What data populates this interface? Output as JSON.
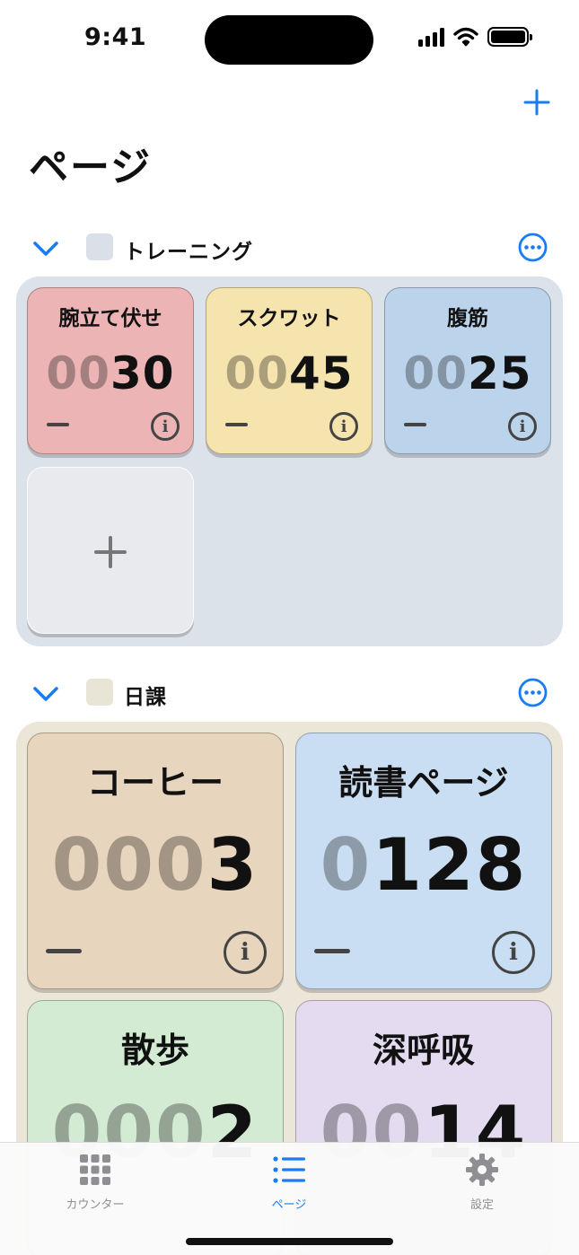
{
  "status": {
    "time": "9:41"
  },
  "page_title": "ページ",
  "colors": {
    "accent": "#1a7cf2"
  },
  "groups": [
    {
      "name": "トレーニング",
      "color": "#d9e0e8",
      "panel_color": "#dce2ea",
      "counters": [
        {
          "name": "腕立て伏せ",
          "count_dim": "00",
          "count_main": "30",
          "color": "#ecb4b4"
        },
        {
          "name": "スクワット",
          "count_dim": "00",
          "count_main": "45",
          "color": "#f6e4ae"
        },
        {
          "name": "腹筋",
          "count_dim": "00",
          "count_main": "25",
          "color": "#bcd3ec"
        }
      ]
    },
    {
      "name": "日課",
      "color": "#e8e4d6",
      "panel_color": "#ece6d8",
      "counters": [
        {
          "name": "コーヒー",
          "count_dim": "000",
          "count_main": "3",
          "color": "#e8d5bd"
        },
        {
          "name": "読書ページ",
          "count_dim": "0",
          "count_main": "128",
          "color": "#c9def2"
        },
        {
          "name": "散歩",
          "count_dim": "000",
          "count_main": "2",
          "color": "#d3ead3"
        },
        {
          "name": "深呼吸",
          "count_dim": "00",
          "count_main": "14",
          "color": "#e4dbf0"
        }
      ]
    }
  ],
  "tabs": [
    {
      "label": "カウンター",
      "icon": "grid-icon"
    },
    {
      "label": "ページ",
      "icon": "list-icon"
    },
    {
      "label": "設定",
      "icon": "gear-icon"
    }
  ],
  "active_tab": "ページ"
}
